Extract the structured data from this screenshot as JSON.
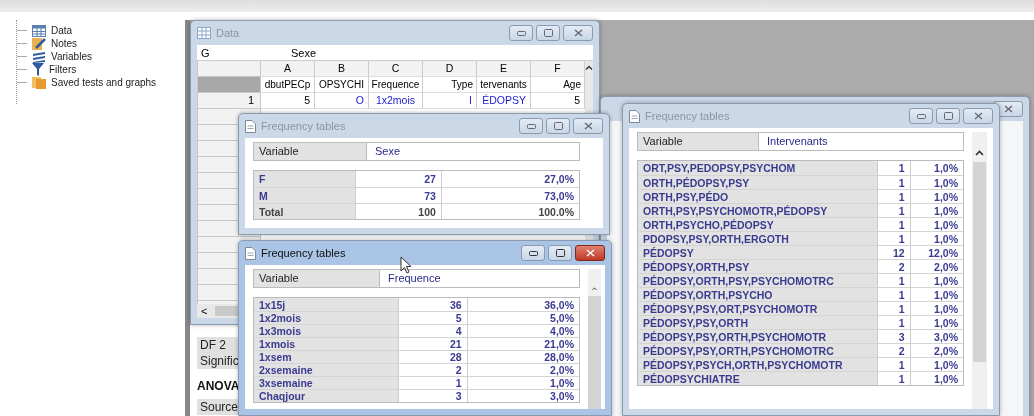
{
  "sidebar": {
    "items": [
      {
        "label": "Data",
        "kind": "table"
      },
      {
        "label": "Notes",
        "kind": "notes"
      },
      {
        "label": "Variables",
        "kind": "layers"
      },
      {
        "label": "Filters",
        "kind": "filter"
      },
      {
        "label": "Saved tests and graphs",
        "kind": "folder"
      }
    ]
  },
  "results_panel": {
    "items": [
      {
        "text": "DF 2",
        "kind": "cell"
      },
      {
        "text": "Signific",
        "kind": "cell"
      },
      {
        "text": "ANOVA",
        "kind": "heading"
      },
      {
        "text": "Source",
        "kind": "cell"
      }
    ]
  },
  "data_window": {
    "title": "Data",
    "active": false,
    "cell_ref": "G",
    "cell_value": "Sexe",
    "columns": [
      "A",
      "B",
      "C",
      "D",
      "E",
      "F"
    ],
    "variable_names": [
      "dbutPECp",
      "OPSYCHI",
      "Frequence",
      "Type",
      "tervenants",
      "Age"
    ],
    "rows": [
      {
        "number": "1",
        "cells": [
          {
            "text": "5",
            "coded": false
          },
          {
            "text": "O",
            "coded": true
          },
          {
            "text": "1x2mois",
            "coded": true
          },
          {
            "text": "I",
            "coded": true
          },
          {
            "text": "ÉDOPSY",
            "coded": true
          },
          {
            "text": "5",
            "coded": false
          }
        ]
      }
    ],
    "scroll_arrow": "<"
  },
  "back_window": {
    "active": false
  },
  "frequency_windows": [
    {
      "title": "Frequency tables",
      "active": false,
      "variable_label": "Variable",
      "variable": "Sexe",
      "scrollbar": false,
      "rows": [
        {
          "label": "F",
          "count": "27",
          "percent": "27,0%"
        },
        {
          "label": "M",
          "count": "73",
          "percent": "73,0%"
        },
        {
          "label": "Total",
          "count": "100",
          "percent": "100.0%",
          "total": true
        }
      ]
    },
    {
      "title": "Frequency tables",
      "active": true,
      "variable_label": "Variable",
      "variable": "Frequence",
      "scrollbar": true,
      "rows": [
        {
          "label": "1x15j",
          "count": "36",
          "percent": "36,0%"
        },
        {
          "label": "1x2mois",
          "count": "5",
          "percent": "5,0%"
        },
        {
          "label": "1x3mois",
          "count": "4",
          "percent": "4,0%"
        },
        {
          "label": "1xmois",
          "count": "21",
          "percent": "21,0%"
        },
        {
          "label": "1xsem",
          "count": "28",
          "percent": "28,0%"
        },
        {
          "label": "2xsemaine",
          "count": "2",
          "percent": "2,0%"
        },
        {
          "label": "3xsemaine",
          "count": "1",
          "percent": "1,0%"
        },
        {
          "label": "Chaqjour",
          "count": "3",
          "percent": "3,0%"
        }
      ]
    },
    {
      "title": "Frequency tables",
      "active": false,
      "variable_label": "Variable",
      "variable": "Intervenants",
      "scrollbar": true,
      "rows": [
        {
          "label": "ORT,PSY,PEDOPSY,PSYCHOM",
          "count": "1",
          "percent": "1,0%"
        },
        {
          "label": "ORTH,PÉDOPSY,PSY",
          "count": "1",
          "percent": "1,0%"
        },
        {
          "label": "ORTH,PSY,PÉDO",
          "count": "1",
          "percent": "1,0%"
        },
        {
          "label": "ORTH,PSY,PSYCHOMOTR,PÉDOPSY",
          "count": "1",
          "percent": "1,0%"
        },
        {
          "label": "ORTH,PSYCHO,PÉDOPSY",
          "count": "1",
          "percent": "1,0%"
        },
        {
          "label": "PDOPSY,PSY,ORTH,ERGOTH",
          "count": "1",
          "percent": "1,0%"
        },
        {
          "label": "PÉDOPSY",
          "count": "12",
          "percent": "12,0%"
        },
        {
          "label": "PÉDOPSY,ORTH,PSY",
          "count": "2",
          "percent": "2,0%"
        },
        {
          "label": "PÉDOPSY,ORTH,PSY,PSYCHOMOTRC",
          "count": "1",
          "percent": "1,0%"
        },
        {
          "label": "PÉDOPSY,ORTH,PSYCHO",
          "count": "1",
          "percent": "1,0%"
        },
        {
          "label": "PÉDOPSY,PSY,ORT,PSYCHOMOTR",
          "count": "1",
          "percent": "1,0%"
        },
        {
          "label": "PÉDOPSY,PSY,ORTH",
          "count": "1",
          "percent": "1,0%"
        },
        {
          "label": "PÉDOPSY,PSY,ORTH,PSYCHOMOTR",
          "count": "3",
          "percent": "3,0%"
        },
        {
          "label": "PÉDOPSY,PSY,ORTH,PSYCHOMOTRC",
          "count": "2",
          "percent": "2,0%"
        },
        {
          "label": "PÉDOPSY,PSYCH,ORTH,PSYCHOMOTR",
          "count": "1",
          "percent": "1,0%"
        },
        {
          "label": "PÉDOPSYCHIATRE",
          "count": "1",
          "percent": "1,0%"
        }
      ]
    }
  ]
}
